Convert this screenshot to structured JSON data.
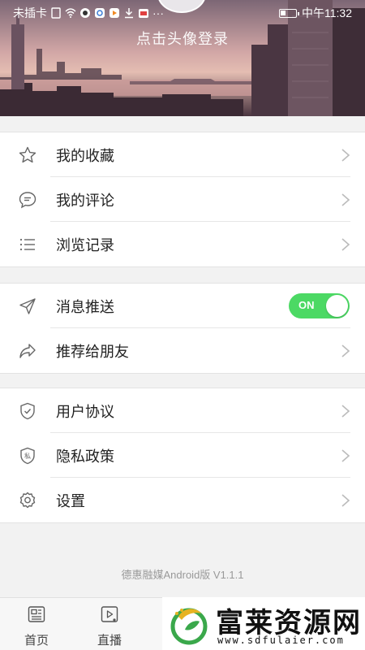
{
  "status_bar": {
    "carrier": "未插卡",
    "time": "中午11:32",
    "more": "···"
  },
  "header": {
    "login_prompt": "点击头像登录"
  },
  "menu_group_1": [
    {
      "label": "我的收藏",
      "icon": "star-icon"
    },
    {
      "label": "我的评论",
      "icon": "comment-icon"
    },
    {
      "label": "浏览记录",
      "icon": "list-icon"
    }
  ],
  "menu_group_2": {
    "push": {
      "label": "消息推送",
      "icon": "send-icon",
      "toggle_label": "ON",
      "toggle_on": true
    },
    "share": {
      "label": "推荐给朋友",
      "icon": "share-icon"
    }
  },
  "menu_group_3": [
    {
      "label": "用户协议",
      "icon": "shield-check-icon"
    },
    {
      "label": "隐私政策",
      "icon": "shield-private-icon",
      "badge_text": "私"
    },
    {
      "label": "设置",
      "icon": "gear-icon"
    }
  ],
  "version": "德惠融媒Android版 V1.1.1",
  "tabbar": [
    {
      "label": "首页",
      "icon": "news-icon"
    },
    {
      "label": "直播",
      "icon": "live-video-icon"
    }
  ],
  "watermark": {
    "title": "富莱资源网",
    "url": "www.sdfulaier.com"
  },
  "colors": {
    "toggle_on": "#4cd964",
    "icon_gray": "#666666",
    "divider": "#e6e6e6"
  }
}
